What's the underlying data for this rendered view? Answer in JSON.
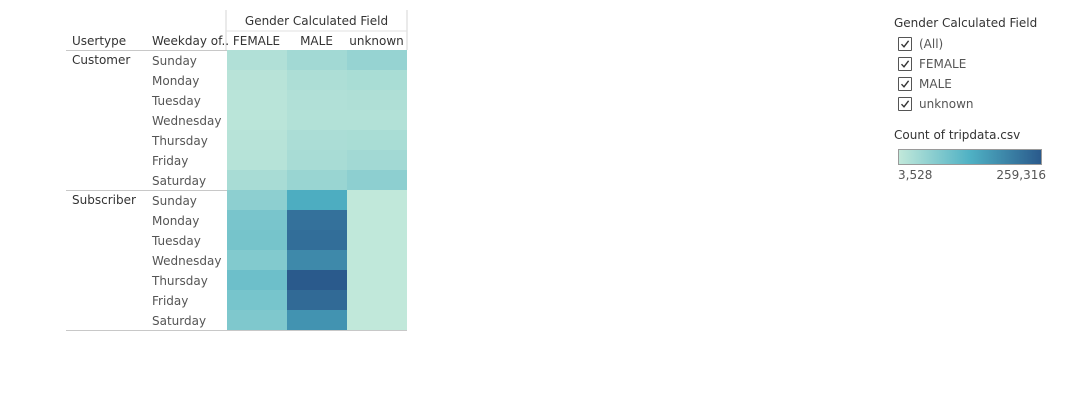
{
  "chart_data": {
    "type": "heatmap",
    "column_group_title": "Gender Calculated Field",
    "row_headers": [
      "Usertype",
      "Weekday of.."
    ],
    "columns": [
      "FEMALE",
      "MALE",
      "unknown"
    ],
    "row_groups": [
      {
        "name": "Customer",
        "rows": [
          {
            "label": "Sunday",
            "values": [
              22000,
              38000,
              52000
            ]
          },
          {
            "label": "Monday",
            "values": [
              14000,
              26000,
              30000
            ]
          },
          {
            "label": "Tuesday",
            "values": [
              12000,
              22000,
              24000
            ]
          },
          {
            "label": "Wednesday",
            "values": [
              11000,
              20000,
              20000
            ]
          },
          {
            "label": "Thursday",
            "values": [
              15000,
              28000,
              30000
            ]
          },
          {
            "label": "Friday",
            "values": [
              16000,
              32000,
              38000
            ]
          },
          {
            "label": "Saturday",
            "values": [
              32000,
              48000,
              62000
            ]
          }
        ]
      },
      {
        "name": "Subscriber",
        "rows": [
          {
            "label": "Sunday",
            "values": [
              62000,
              138000,
              4000
            ]
          },
          {
            "label": "Monday",
            "values": [
              84000,
              225000,
              4500
            ]
          },
          {
            "label": "Tuesday",
            "values": [
              88000,
              230000,
              4200
            ]
          },
          {
            "label": "Wednesday",
            "values": [
              74000,
              190000,
              4100
            ]
          },
          {
            "label": "Thursday",
            "values": [
              98000,
              259316,
              4300
            ]
          },
          {
            "label": "Friday",
            "values": [
              86000,
              236000,
              4000
            ]
          },
          {
            "label": "Saturday",
            "values": [
              78000,
              175000,
              3528
            ]
          }
        ]
      }
    ],
    "color_scale": {
      "min": 3528,
      "max": 259316,
      "min_label": "3,528",
      "max_label": "259,316",
      "colors": [
        "#c1e8da",
        "#4fb1c4",
        "#2a5a8c"
      ]
    }
  },
  "filter": {
    "title": "Gender Calculated Field",
    "items": [
      {
        "label": "(All)",
        "checked": true
      },
      {
        "label": "FEMALE",
        "checked": true
      },
      {
        "label": "MALE",
        "checked": true
      },
      {
        "label": "unknown",
        "checked": true
      }
    ]
  },
  "legend": {
    "title": "Count of tripdata.csv"
  }
}
